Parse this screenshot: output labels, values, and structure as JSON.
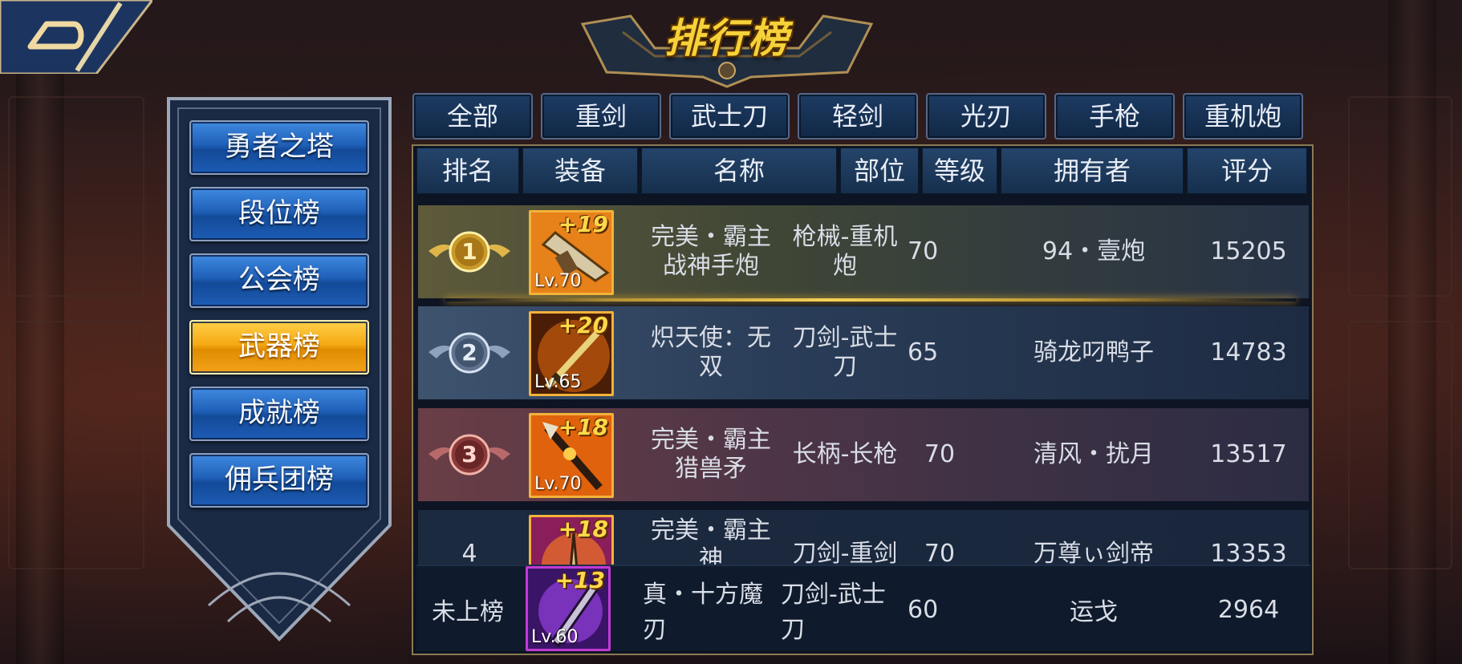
{
  "title": "排行榜",
  "side_menu": [
    {
      "label": "勇者之塔",
      "active": false
    },
    {
      "label": "段位榜",
      "active": false
    },
    {
      "label": "公会榜",
      "active": false
    },
    {
      "label": "武器榜",
      "active": true
    },
    {
      "label": "成就榜",
      "active": false
    },
    {
      "label": "佣兵团榜",
      "active": false
    }
  ],
  "tabs": [
    "全部",
    "重剑",
    "武士刀",
    "轻剑",
    "光刃",
    "手枪",
    "重机炮"
  ],
  "columns": [
    "排名",
    "装备",
    "名称",
    "部位",
    "等级",
    "拥有者",
    "评分"
  ],
  "rows": [
    {
      "rank": "1",
      "plus": "+19",
      "lv": "Lv.70",
      "name": "完美・霸主战神手炮",
      "part": "枪械-重机炮",
      "level": "70",
      "owner": "94・壹炮",
      "score": "15205",
      "icon": "gun-icon"
    },
    {
      "rank": "2",
      "plus": "+20",
      "lv": "Lv.65",
      "name": "炽天使：无双",
      "part": "刀剑-武士刀",
      "level": "65",
      "owner": "骑龙叼鸭子",
      "score": "14783",
      "icon": "katana-icon"
    },
    {
      "rank": "3",
      "plus": "+18",
      "lv": "Lv.70",
      "name": "完美・霸主猎兽矛",
      "part": "长柄-长枪",
      "level": "70",
      "owner": "清风・扰月",
      "score": "13517",
      "icon": "spear-icon"
    },
    {
      "rank": "4",
      "plus": "+18",
      "lv": "",
      "name": "完美・霸主神",
      "part": "刀剑-重剑",
      "level": "70",
      "owner": "万尊ぃ剑帝",
      "score": "13353",
      "icon": "greatsword-icon"
    }
  ],
  "my_rank": {
    "rank": "未上榜",
    "plus": "+13",
    "lv": "Lv.60",
    "name": "真・十方魔刃",
    "part": "刀剑-武士刀",
    "level": "60",
    "owner": "运戈",
    "score": "2964",
    "icon": "dark-blade-icon"
  },
  "colors": {
    "gold": "#f2b23a",
    "purple": "#c23ad6",
    "active_tab": "#f5a912",
    "menu_blue": "#1f5fb8"
  }
}
